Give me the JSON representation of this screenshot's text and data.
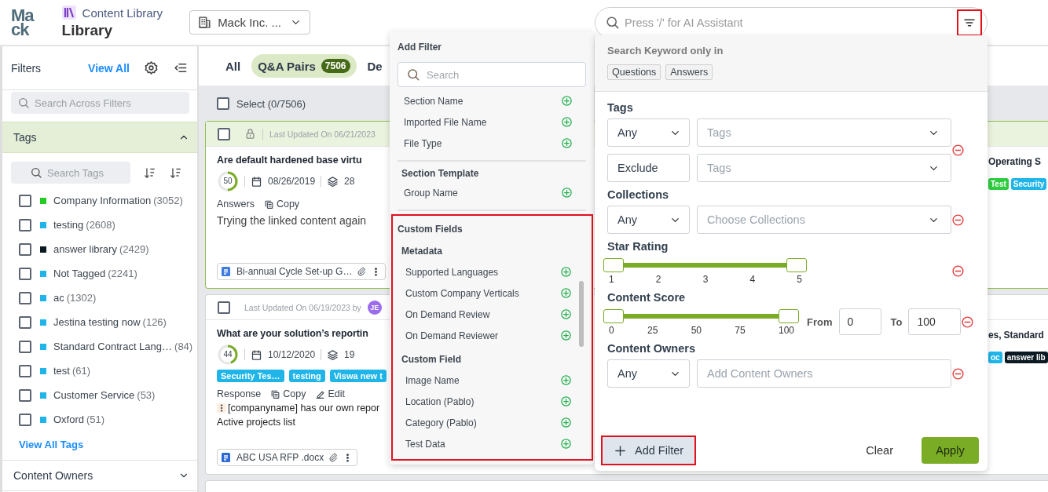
{
  "header": {
    "logo_lines": [
      "Ma",
      "ck"
    ],
    "breadcrumb": "Content Library",
    "title": "Library",
    "company": "Mack Inc. ..."
  },
  "ai_search": {
    "placeholder": "Press '/' for AI Assistant",
    "filter_highlighted": true
  },
  "sidebar": {
    "title": "Filters",
    "view_all": "View All",
    "search_placeholder": "Search Across Filters",
    "tags": {
      "title": "Tags",
      "expanded": true,
      "search_placeholder": "Search Tags",
      "view_all": "View All Tags",
      "items": [
        {
          "name": "Company Information",
          "count": "(3052)",
          "color": "#22cc22",
          "checked": false
        },
        {
          "name": "testing",
          "count": "(2608)",
          "color": "#1fb5e8",
          "checked": false
        },
        {
          "name": "answer library",
          "count": "(2429)",
          "color": "#0b1a22",
          "checked": false
        },
        {
          "name": "Not Tagged",
          "count": "(2241)",
          "color": "#1fb5e8",
          "checked": false
        },
        {
          "name": "ac",
          "count": "(1302)",
          "color": "#1fb5e8",
          "checked": false
        },
        {
          "name": "Jestina testing now",
          "count": "(126)",
          "color": "#1fb5e8",
          "checked": false
        },
        {
          "name": "Standard Contract Lang…",
          "count": "(84)",
          "color": "#1fb5e8",
          "checked": false
        },
        {
          "name": "test",
          "count": "(61)",
          "color": "#1fb5e8",
          "checked": false
        },
        {
          "name": "Customer Service",
          "count": "(53)",
          "color": "#1fb5e8",
          "checked": false
        },
        {
          "name": "Oxford",
          "count": "(51)",
          "color": "#1fb5e8",
          "checked": false
        }
      ]
    },
    "content_owners": {
      "title": "Content Owners",
      "expanded": false
    }
  },
  "tabs": [
    {
      "label": "All",
      "selected": false
    },
    {
      "label": "Q&A Pairs",
      "count": "7506",
      "selected": true
    },
    {
      "label": "De",
      "selected": false
    }
  ],
  "select_all": {
    "label": "Select (0/7506)",
    "checked": false
  },
  "cards": [
    {
      "highlighted": true,
      "locked": true,
      "checked": false,
      "updated": "Last Updated On 06/21/2023",
      "title": "Are default hardened base virtu",
      "score": "50",
      "level": 0.5,
      "date": "08/26/2019",
      "count": "28",
      "answer_label": "Answers",
      "actions": [
        "Copy"
      ],
      "body": [
        "Trying the linked content again"
      ],
      "attachment": {
        "kind": "doc",
        "name": "Bi-annual Cycle Set-up G…"
      },
      "right_title": "Operating S",
      "right_tags": [
        {
          "label": "Test",
          "color": "#2ecc40"
        },
        {
          "label": "Security",
          "color": "#1fb5e8"
        }
      ]
    },
    {
      "highlighted": false,
      "locked": false,
      "checked": false,
      "updated": "Last Updated On 06/19/2023 by",
      "avatar": {
        "initials": "JE",
        "color": "#9b6cf0"
      },
      "title": "What are your solution’s reportin",
      "score": "44",
      "level": 0.44,
      "date": "10/12/2020",
      "count": "19",
      "tags": [
        {
          "label": "Security Tes…",
          "color": "#1fb5e8"
        },
        {
          "label": "testing",
          "color": "#1fb5e8"
        },
        {
          "label": "Viswa new t",
          "color": "#1fb5e8"
        }
      ],
      "answer_label": "Response",
      "actions": [
        "Copy",
        "Edit"
      ],
      "body": [
        "[companyname] has our own repor",
        "Active projects list"
      ],
      "attachment": {
        "kind": "word",
        "name": "ABC USA RFP .docx"
      },
      "right_title": "es, Standard",
      "right_tags": [
        {
          "label": "oc",
          "color": "#1fb5e8"
        },
        {
          "label": "answer lib",
          "color": "#0b1a22"
        }
      ]
    }
  ],
  "add_filter_menu": {
    "title": "Add Filter",
    "search_placeholder": "Search",
    "groups": [
      {
        "highlighted": false,
        "items": [
          "Section Name",
          "Imported File Name",
          "File Type"
        ]
      },
      {
        "highlighted": false,
        "title": "Section Template",
        "items": [
          "Group Name"
        ]
      },
      {
        "highlighted": true,
        "title": "Custom Fields",
        "subgroups": [
          {
            "title": "Metadata",
            "items": [
              "Supported Languages",
              "Custom Company Verticals",
              "On Demand Review",
              "On Demand Reviewer"
            ]
          },
          {
            "title": "Custom Field",
            "items": [
              "Image Name",
              "Location (Pablo)",
              "Category (Pablo)",
              "Test Data"
            ]
          }
        ]
      }
    ]
  },
  "filter_panel": {
    "keyword_title": "Search Keyword only in",
    "keyword_chips": [
      "Questions",
      "Answers"
    ],
    "sections": [
      {
        "kind": "select",
        "title": "Tags",
        "rows": [
          {
            "mode": "Any",
            "mode_dropdown": true,
            "placeholder": "Tags",
            "dropdown": true
          },
          {
            "mode": "Exclude",
            "mode_dropdown": false,
            "placeholder": "Tags",
            "dropdown": true
          }
        ]
      },
      {
        "kind": "select",
        "title": "Collections",
        "rows": [
          {
            "mode": "Any",
            "mode_dropdown": true,
            "placeholder": "Choose Collections",
            "dropdown": true
          }
        ]
      },
      {
        "kind": "range",
        "title": "Star Rating",
        "ticks": [
          "1",
          "2",
          "3",
          "4",
          "5"
        ],
        "level": 1
      },
      {
        "kind": "range",
        "title": "Content Score",
        "ticks": [
          "0",
          "25",
          "50",
          "75",
          "100"
        ],
        "level": 1,
        "from_label": "From",
        "from": "0",
        "to_label": "To",
        "to": "100"
      },
      {
        "kind": "select",
        "title": "Content Owners",
        "rows": [
          {
            "mode": "Any",
            "mode_dropdown": true,
            "placeholder": "Add Content Owners",
            "dropdown": false
          }
        ]
      }
    ],
    "add_filter": {
      "label": "Add Filter",
      "highlighted": true
    },
    "clear": "Clear",
    "apply": "Apply"
  }
}
